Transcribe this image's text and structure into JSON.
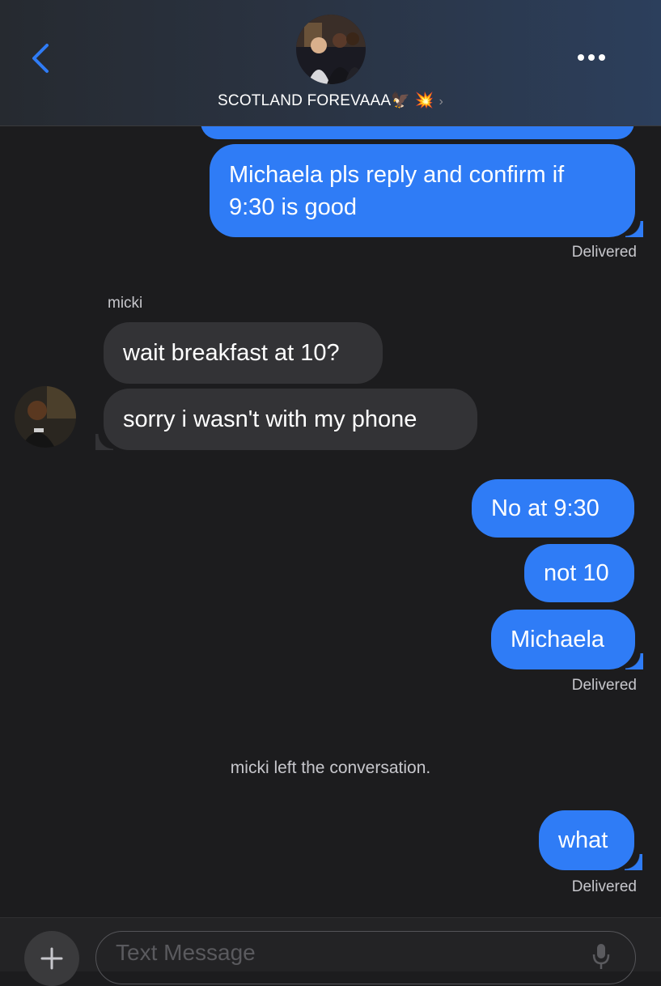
{
  "header": {
    "title": "SCOTLAND FOREVAAA",
    "title_emoji": "🦅 💥",
    "chevron": "›",
    "back_icon": "chevron-left-icon",
    "more_icon": "ellipsis-icon"
  },
  "messages": [
    {
      "from": "me",
      "text": "Michaela pls reply and confirm if 9:30 is good"
    },
    {
      "from": "micki",
      "text": "wait breakfast at 10?"
    },
    {
      "from": "micki",
      "text": "sorry i wasn't with my phone"
    },
    {
      "from": "me",
      "text": "No at 9:30"
    },
    {
      "from": "me",
      "text": "not 10"
    },
    {
      "from": "me",
      "text": "Michaela"
    },
    {
      "from": "me",
      "text": "what"
    }
  ],
  "status": {
    "delivered_1": "Delivered",
    "delivered_2": "Delivered",
    "delivered_3": "Delivered"
  },
  "sender_name": "micki",
  "system_note": "micki left the conversation.",
  "composer": {
    "placeholder": "Text Message",
    "plus_icon": "plus-icon",
    "mic_icon": "microphone-icon"
  },
  "colors": {
    "outgoing_bubble": "#2f7cf6",
    "incoming_bubble": "#333336",
    "background": "#1c1c1e",
    "accent": "#2f7cf6"
  }
}
